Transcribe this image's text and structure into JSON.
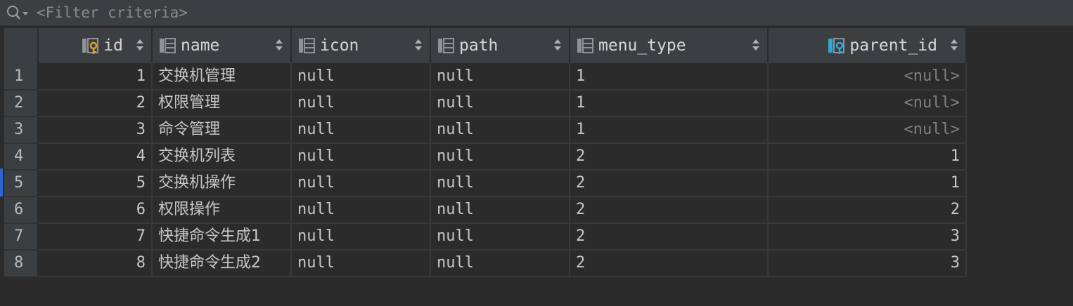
{
  "filter": {
    "placeholder": "<Filter criteria>",
    "icon": "search-filter-icon"
  },
  "columns": [
    {
      "key": "id",
      "label": "id",
      "icon": "primary-key-column-icon",
      "align": "right"
    },
    {
      "key": "name",
      "label": "name",
      "icon": "column-icon",
      "align": "left"
    },
    {
      "key": "icon",
      "label": "icon",
      "icon": "column-icon",
      "align": "left"
    },
    {
      "key": "path",
      "label": "path",
      "icon": "column-icon",
      "align": "left"
    },
    {
      "key": "menu_type",
      "label": "menu_type",
      "icon": "column-icon",
      "align": "left"
    },
    {
      "key": "parent_id",
      "label": "parent_id",
      "icon": "foreign-key-column-icon",
      "align": "right"
    }
  ],
  "rows": [
    {
      "num": "1",
      "id": "1",
      "name": "交换机管理",
      "icon": "null",
      "path": "null",
      "menu_type": "1",
      "parent_id": "<null>"
    },
    {
      "num": "2",
      "id": "2",
      "name": "权限管理",
      "icon": "null",
      "path": "null",
      "menu_type": "1",
      "parent_id": "<null>"
    },
    {
      "num": "3",
      "id": "3",
      "name": "命令管理",
      "icon": "null",
      "path": "null",
      "menu_type": "1",
      "parent_id": "<null>"
    },
    {
      "num": "4",
      "id": "4",
      "name": "交换机列表",
      "icon": "null",
      "path": "null",
      "menu_type": "2",
      "parent_id": "1"
    },
    {
      "num": "5",
      "id": "5",
      "name": "交换机操作",
      "icon": "null",
      "path": "null",
      "menu_type": "2",
      "parent_id": "1"
    },
    {
      "num": "6",
      "id": "6",
      "name": "权限操作",
      "icon": "null",
      "path": "null",
      "menu_type": "2",
      "parent_id": "2"
    },
    {
      "num": "7",
      "id": "7",
      "name": "快捷命令生成1",
      "icon": "null",
      "path": "null",
      "menu_type": "2",
      "parent_id": "3"
    },
    {
      "num": "8",
      "id": "8",
      "name": "快捷命令生成2",
      "icon": "null",
      "path": "null",
      "menu_type": "2",
      "parent_id": "3"
    }
  ],
  "colors": {
    "background": "#2b2b2b",
    "header": "#3c3f41",
    "key_icon": "#e0a030",
    "fk_icon": "#2ea8d8",
    "null_text": "#808080"
  }
}
